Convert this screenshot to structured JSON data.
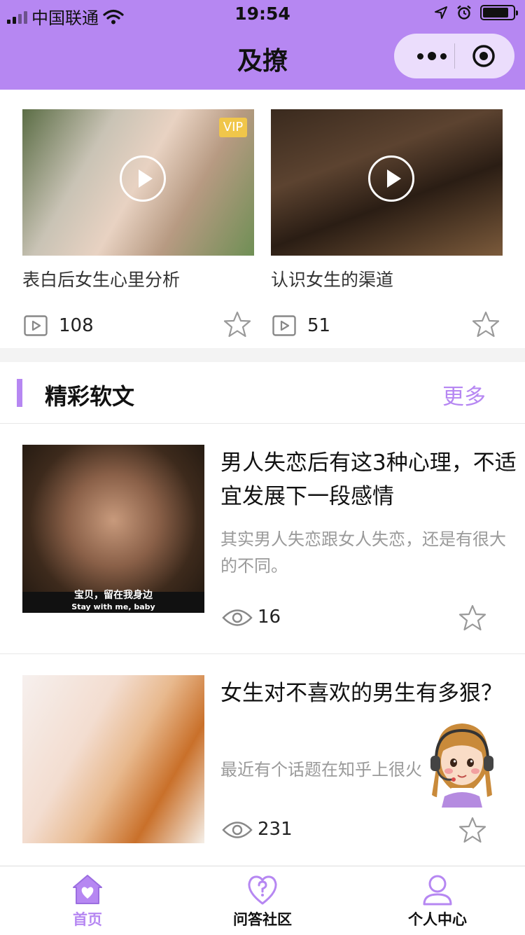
{
  "status_bar": {
    "carrier": "中国联通",
    "time": "19:54"
  },
  "nav": {
    "title": "及撩"
  },
  "colors": {
    "accent": "#b687f2",
    "vip": "#f0c64a"
  },
  "videos": [
    {
      "title": "表白后女生心里分析",
      "plays": "108",
      "badge": "VIP",
      "icon": "play-icon"
    },
    {
      "title": "认识女生的渠道",
      "plays": "51",
      "badge": "",
      "icon": "play-icon"
    }
  ],
  "section": {
    "title": "精彩软文",
    "more": "更多"
  },
  "articles": [
    {
      "title": "男人失恋后有这3种心理，不适宜发展下一段感情",
      "desc": "其实男人失恋跟女人失恋，还是有很大的不同。",
      "views": "16",
      "caption_cn": "宝贝，留在我身边",
      "caption_en": "Stay with me, baby"
    },
    {
      "title": "女生对不喜欢的男生有多狠？",
      "desc": "最近有个话题在知乎上很火",
      "views": "231"
    }
  ],
  "tabs": [
    {
      "label": "首页",
      "icon": "home-heart-icon",
      "active": true
    },
    {
      "label": "问答社区",
      "icon": "question-heart-icon",
      "active": false
    },
    {
      "label": "个人中心",
      "icon": "user-icon",
      "active": false
    }
  ]
}
